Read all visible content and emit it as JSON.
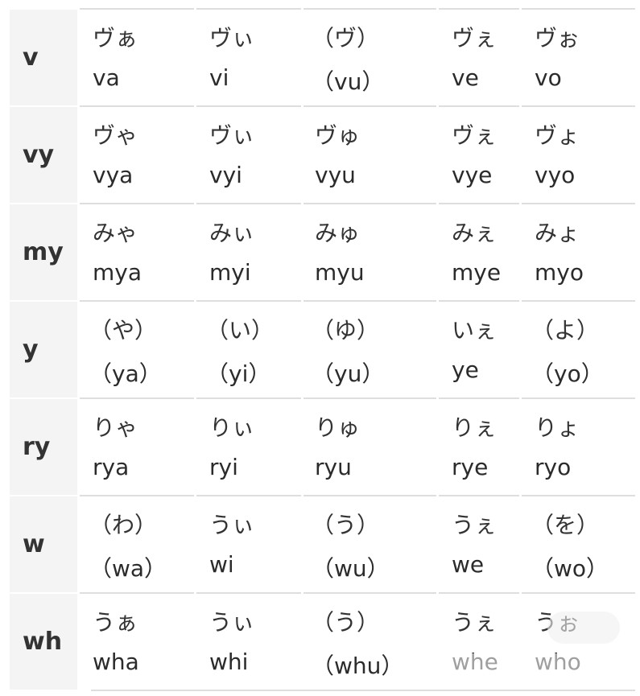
{
  "table": {
    "rows": [
      {
        "head": "v",
        "cells": [
          {
            "kana": "ヴぁ",
            "romaji": "va"
          },
          {
            "kana": "ヴぃ",
            "romaji": "vi"
          },
          {
            "kana": "（ヴ）",
            "romaji": "（vu）"
          },
          {
            "kana": "ヴぇ",
            "romaji": "ve"
          },
          {
            "kana": "ヴぉ",
            "romaji": "vo"
          }
        ]
      },
      {
        "head": "vy",
        "cells": [
          {
            "kana": "ヴゃ",
            "romaji": "vya"
          },
          {
            "kana": "ヴぃ",
            "romaji": "vyi"
          },
          {
            "kana": "ヴゅ",
            "romaji": "vyu"
          },
          {
            "kana": "ヴぇ",
            "romaji": "vye"
          },
          {
            "kana": "ヴょ",
            "romaji": "vyo"
          }
        ]
      },
      {
        "head": "my",
        "cells": [
          {
            "kana": "みゃ",
            "romaji": "mya"
          },
          {
            "kana": "みぃ",
            "romaji": "myi"
          },
          {
            "kana": "みゅ",
            "romaji": "myu"
          },
          {
            "kana": "みぇ",
            "romaji": "mye"
          },
          {
            "kana": "みょ",
            "romaji": "myo"
          }
        ]
      },
      {
        "head": "y",
        "cells": [
          {
            "kana": "（や）",
            "romaji": "（ya）"
          },
          {
            "kana": "（い）",
            "romaji": "（yi）"
          },
          {
            "kana": "（ゆ）",
            "romaji": "（yu）"
          },
          {
            "kana": "いぇ",
            "romaji": "ye"
          },
          {
            "kana": "（よ）",
            "romaji": "（yo）"
          }
        ]
      },
      {
        "head": "ry",
        "cells": [
          {
            "kana": "りゃ",
            "romaji": "rya"
          },
          {
            "kana": "りぃ",
            "romaji": "ryi"
          },
          {
            "kana": "りゅ",
            "romaji": "ryu"
          },
          {
            "kana": "りぇ",
            "romaji": "rye"
          },
          {
            "kana": "りょ",
            "romaji": "ryo"
          }
        ]
      },
      {
        "head": "w",
        "cells": [
          {
            "kana": "（わ）",
            "romaji": "（wa）"
          },
          {
            "kana": "うぃ",
            "romaji": "wi"
          },
          {
            "kana": "（う）",
            "romaji": "（wu）"
          },
          {
            "kana": "うぇ",
            "romaji": "we"
          },
          {
            "kana": "（を）",
            "romaji": "（wo）"
          }
        ]
      },
      {
        "head": "wh",
        "cells": [
          {
            "kana": "うぁ",
            "romaji": "wha"
          },
          {
            "kana": "うぃ",
            "romaji": "whi"
          },
          {
            "kana": "（う）",
            "romaji": "（whu）"
          },
          {
            "kana": "うぇ",
            "romaji": "whe"
          },
          {
            "kana": "うぉ",
            "romaji": "who"
          }
        ]
      }
    ]
  }
}
